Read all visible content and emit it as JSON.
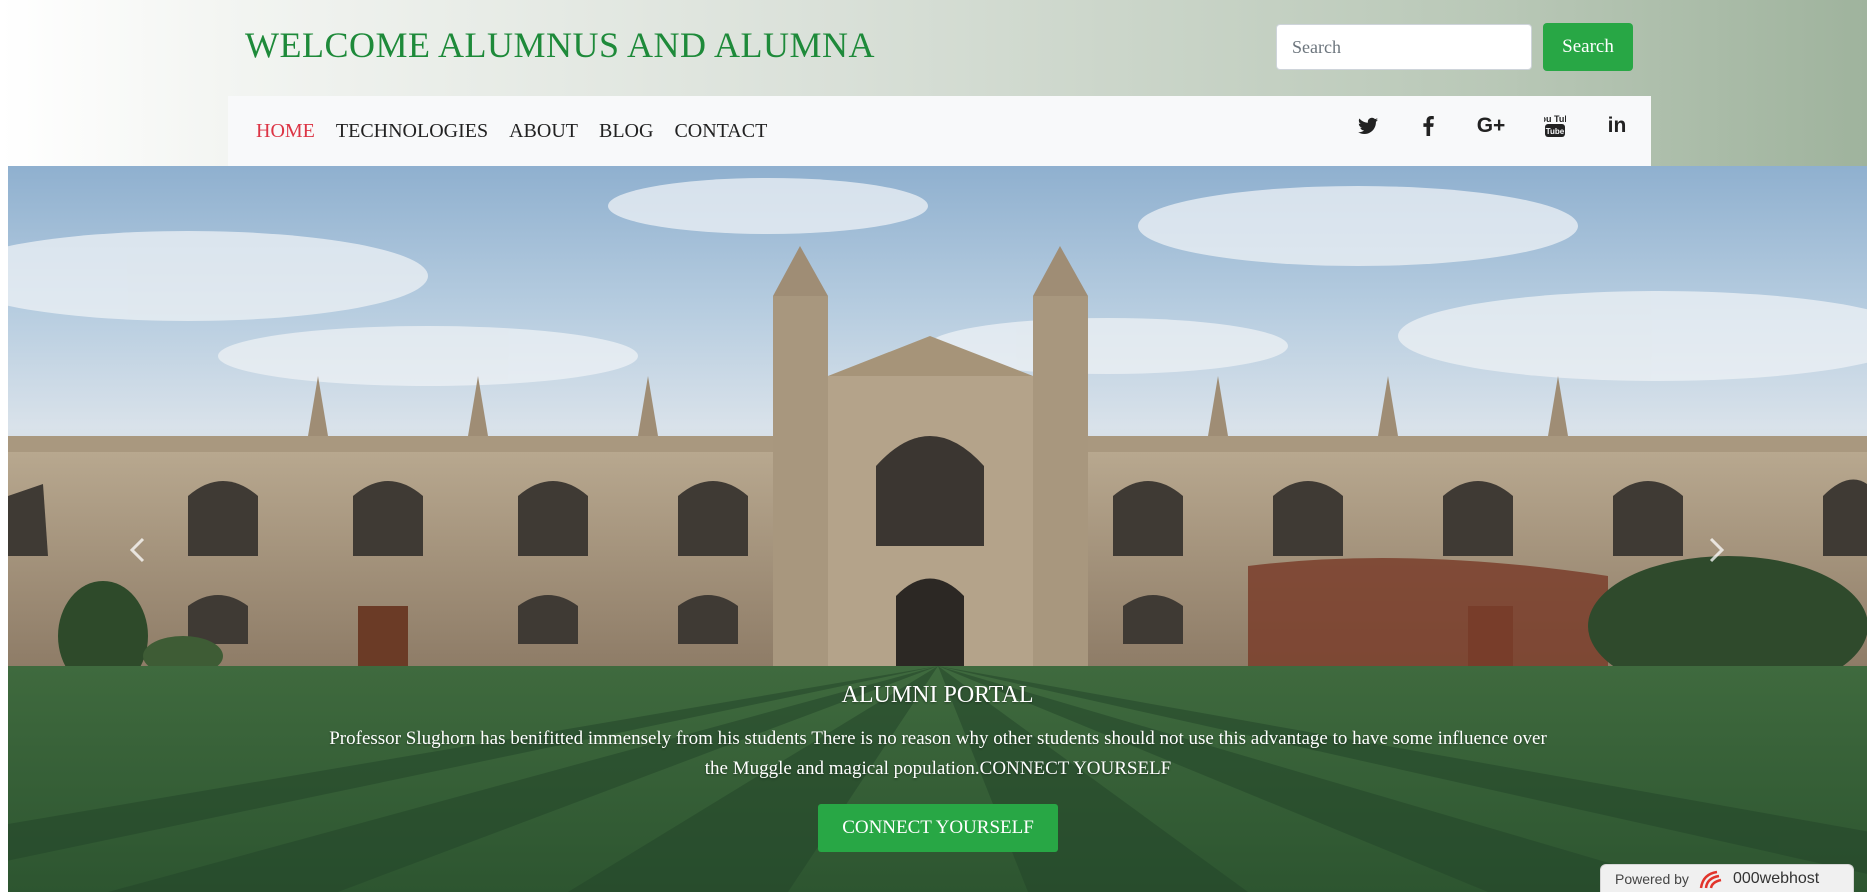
{
  "header": {
    "title": "WELCOME ALUMNUS AND ALUMNA",
    "search_placeholder": "Search",
    "search_button_label": "Search"
  },
  "nav": {
    "items": [
      {
        "label": "HOME",
        "active": true
      },
      {
        "label": "TECHNOLOGIES"
      },
      {
        "label": "ABOUT"
      },
      {
        "label": "BLOG"
      },
      {
        "label": "CONTACT"
      }
    ],
    "social": [
      {
        "icon": "twitter-icon"
      },
      {
        "icon": "facebook-icon"
      },
      {
        "icon": "google-plus-icon",
        "label": "G+"
      },
      {
        "icon": "youtube-icon",
        "label": "You Tube"
      },
      {
        "icon": "linkedin-icon",
        "label": "in"
      }
    ]
  },
  "hero": {
    "caption_title": "ALUMNI PORTAL",
    "caption_text": "Professor Slughorn has benifitted immensely from his students There is no reason why other students should not use this advantage to have some influence over the Muggle and magical population.CONNECT YOURSELF",
    "button_label": "CONNECT YOURSELF",
    "prev_icon": "chevron-left-icon",
    "next_icon": "chevron-right-icon"
  },
  "badge": {
    "powered_label": "Powered by",
    "brand": "000webhost"
  },
  "colors": {
    "accent_green": "#28a745",
    "title_green": "#1e8a3a",
    "active_red": "#dc3545"
  }
}
